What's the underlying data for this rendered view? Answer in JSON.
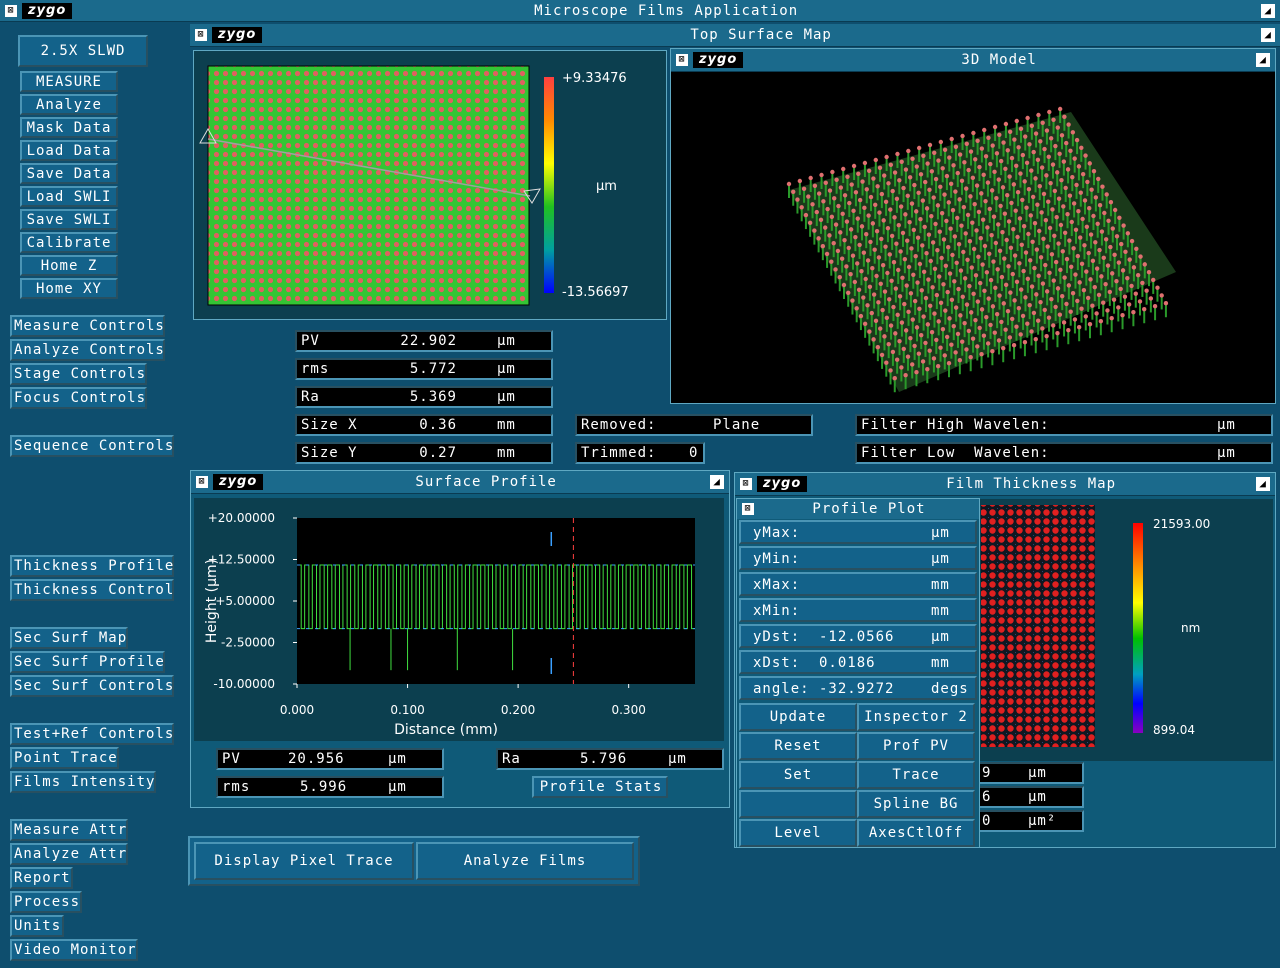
{
  "app": {
    "title": "Microscope Films Application",
    "logo": "zygo"
  },
  "objective": "2.5X SLWD",
  "left_buttons": [
    "MEASURE",
    "Analyze",
    "Mask Data",
    "Load Data",
    "Save Data",
    "Load SWLI",
    "Save SWLI",
    "Calibrate",
    "Home Z",
    "Home XY"
  ],
  "controls_group1": [
    "Measure Controls",
    "Analyze Controls",
    "Stage Controls",
    "Focus Controls"
  ],
  "controls_group2": [
    "Sequence Controls"
  ],
  "controls_group3": [
    "Thickness Profile",
    "Thickness Control"
  ],
  "controls_group4": [
    "Sec Surf Map",
    "Sec Surf Profile",
    "Sec Surf Controls"
  ],
  "controls_group5": [
    "Test+Ref Controls",
    "Point Trace",
    "Films Intensity"
  ],
  "controls_group6": [
    "Measure Attr",
    "Analyze Attr",
    "Report",
    "Process",
    "Units",
    "Video Monitor"
  ],
  "top_surface": {
    "title": "Top Surface Map",
    "scale_max": "+9.33476",
    "scale_min": "-13.56697",
    "unit": "µm",
    "stats": [
      {
        "label": "PV",
        "value": "22.902",
        "unit": "µm"
      },
      {
        "label": "rms",
        "value": "5.772",
        "unit": "µm"
      },
      {
        "label": "Ra",
        "value": "5.369",
        "unit": "µm"
      },
      {
        "label": "Size X",
        "value": "0.36",
        "unit": "mm"
      },
      {
        "label": "Size Y",
        "value": "0.27",
        "unit": "mm"
      }
    ],
    "removed_label": "Removed:",
    "removed_value": "Plane",
    "trimmed_label": "Trimmed:",
    "trimmed_value": "0",
    "filter_high_label": "Filter High Wavelen:",
    "filter_high_unit": "µm",
    "filter_low_label": "Filter Low  Wavelen:",
    "filter_low_unit": "µm"
  },
  "model3d": {
    "title": "3D Model"
  },
  "surface_profile": {
    "title": "Surface Profile",
    "y_ticks": [
      "+20.00000",
      "+12.50000",
      "+5.00000",
      "-2.50000",
      "-10.00000"
    ],
    "x_ticks": [
      "0.000",
      "0.100",
      "0.200",
      "0.300"
    ],
    "ylabel": "Height (µm)",
    "xlabel": "Distance (mm)",
    "stats": [
      {
        "label": "PV",
        "value": "20.956",
        "unit": "µm"
      },
      {
        "label": "rms",
        "value": "5.996",
        "unit": "µm"
      },
      {
        "label": "Ra",
        "value": "5.796",
        "unit": "µm"
      }
    ],
    "profile_stats_button": "Profile Stats"
  },
  "film_thickness": {
    "title": "Film Thickness Map",
    "scale_max": "21593.00",
    "scale_min": "899.04",
    "unit": "nm",
    "side_fields": [
      {
        "value": "9",
        "unit": "µm"
      },
      {
        "value": "6",
        "unit": "µm"
      },
      {
        "value": "0",
        "unit": "µm²"
      }
    ]
  },
  "profile_plot": {
    "title": "Profile Plot",
    "rows": [
      {
        "label": "yMax:",
        "value": "",
        "unit": "µm"
      },
      {
        "label": "yMin:",
        "value": "",
        "unit": "µm"
      },
      {
        "label": "xMax:",
        "value": "",
        "unit": "mm"
      },
      {
        "label": "xMin:",
        "value": "",
        "unit": "mm"
      },
      {
        "label": "yDst:",
        "value": "-12.0566",
        "unit": "µm"
      },
      {
        "label": "xDst:",
        "value": "0.0186",
        "unit": "mm"
      },
      {
        "label": "angle:",
        "value": "-32.9272",
        "unit": "degs"
      }
    ],
    "buttons": [
      "Update",
      "Inspector 2",
      "Reset",
      "Prof PV",
      "Set",
      "Trace",
      "",
      "Spline BG",
      "Level",
      "AxesCtlOff"
    ]
  },
  "bottom_buttons": [
    "Display Pixel Trace",
    "Analyze Films"
  ]
}
